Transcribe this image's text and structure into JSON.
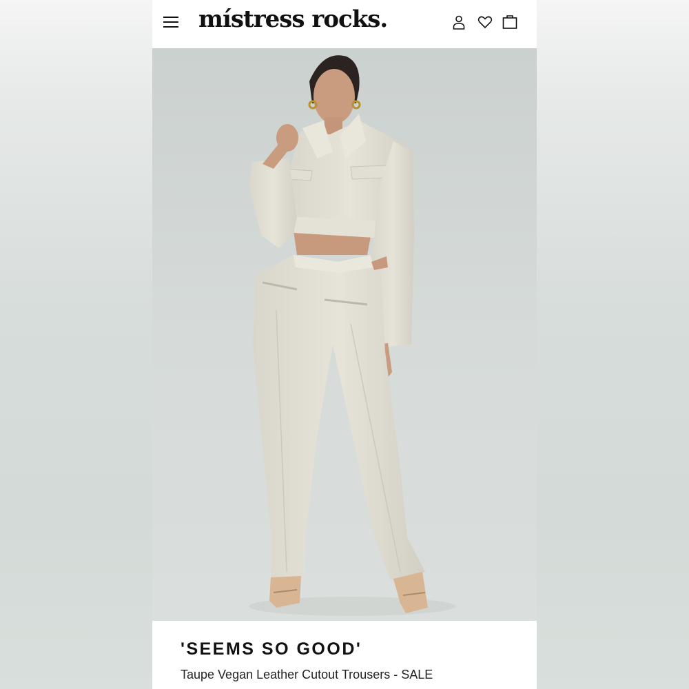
{
  "header": {
    "brand": "místress rocks.",
    "icons": [
      "menu-icon",
      "account-icon",
      "wishlist-icon",
      "bag-icon"
    ]
  },
  "hero": {
    "image": "model-in-cream-cropped-jacket-and-cutout-trousers"
  },
  "product": {
    "title": "'SEEMS SO GOOD'",
    "subtitle": "Taupe Vegan Leather Cutout Trousers - SALE"
  },
  "colors": {
    "garment": "#e3e0d6",
    "background": "#d6dcda",
    "text": "#111111"
  }
}
